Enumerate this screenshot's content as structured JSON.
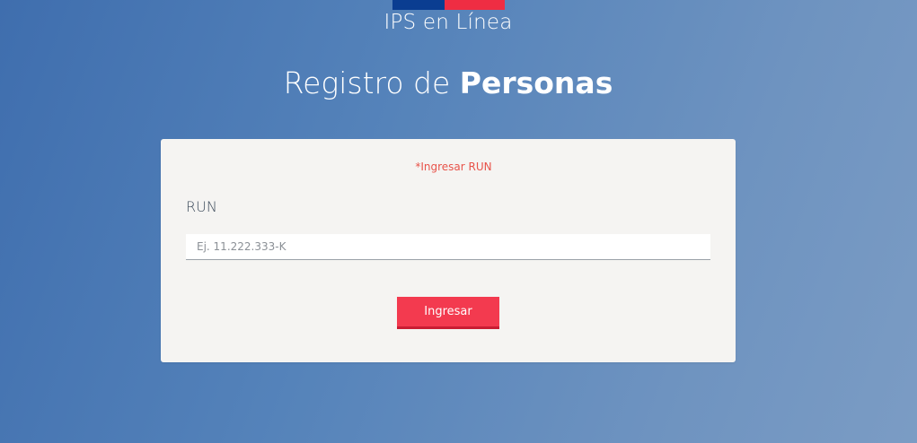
{
  "header": {
    "brand": "IPS en Línea",
    "flag_colors": [
      "#0a3d91",
      "#ef2d43"
    ]
  },
  "page": {
    "title_regular": "Registro de ",
    "title_bold": "Personas"
  },
  "form": {
    "error_message": "*Ingresar RUN",
    "run_label": "RUN",
    "run_value": "",
    "run_placeholder": "Ej. 11.222.333-K",
    "submit_label": "Ingresar"
  },
  "colors": {
    "accent": "#f33a4f",
    "error": "#e8534a",
    "card_background": "#f5f4f2"
  }
}
